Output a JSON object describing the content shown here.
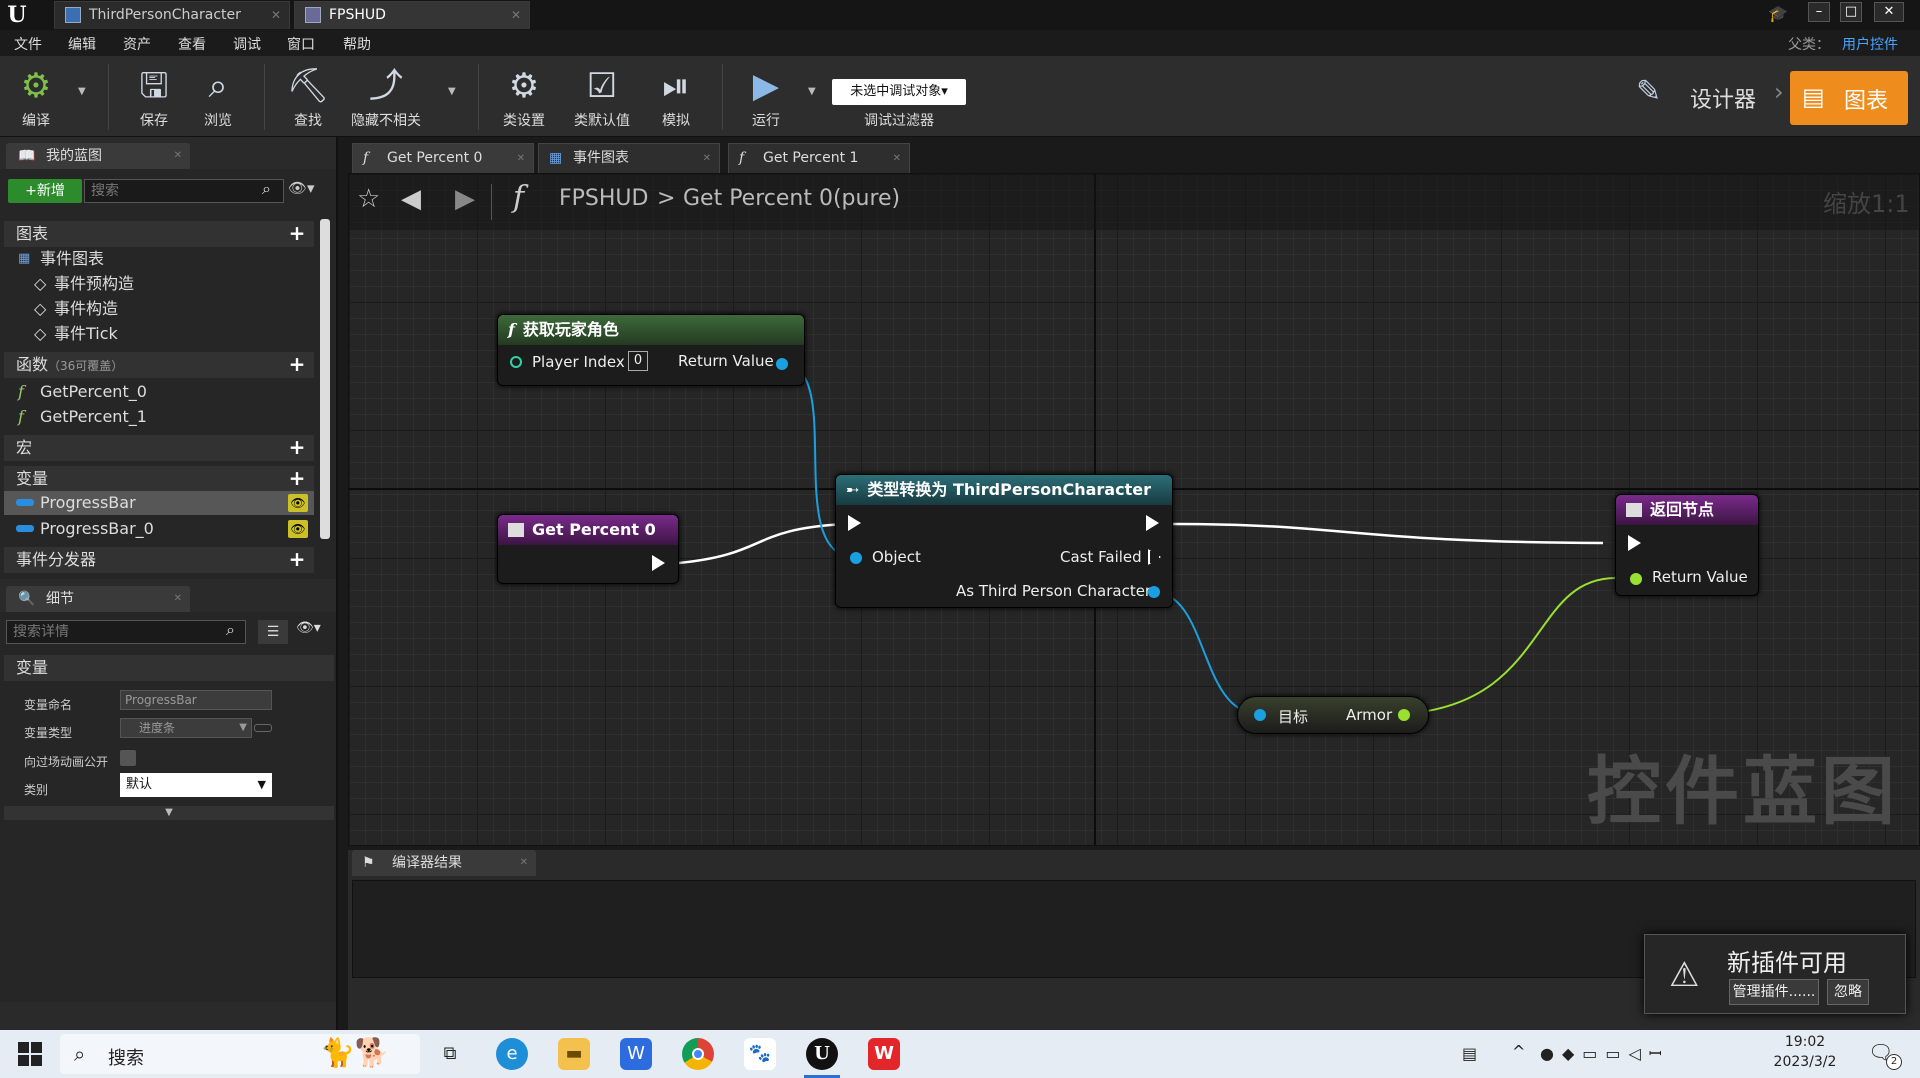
{
  "tabs": {
    "tab1": "ThirdPersonCharacter",
    "tab2": "FPSHUD"
  },
  "menu": [
    "文件",
    "编辑",
    "资产",
    "查看",
    "调试",
    "窗口",
    "帮助"
  ],
  "parent": {
    "label": "父类：",
    "value": "用户控件"
  },
  "toolbar": {
    "compile": "编译",
    "save": "保存",
    "browse": "浏览",
    "find": "查找",
    "hide": "隐藏不相关",
    "classSettings": "类设置",
    "classDefaults": "类默认值",
    "simulate": "模拟",
    "run": "运行",
    "debugDropdown": "未选中调试对象▾",
    "debugFilter": "调试过滤器",
    "designer": "设计器",
    "graph": "图表"
  },
  "myblueprint": {
    "title": "我的蓝图",
    "addNew": "+新增",
    "searchPlaceholder": "搜索",
    "sectionGraphs": "图表",
    "eventGraph": "事件图表",
    "events": [
      "事件预构造",
      "事件构造",
      "事件Tick"
    ],
    "sectionFunctions": "函数",
    "functionsNote": "（36可覆盖）",
    "functions": [
      "GetPercent_0",
      "GetPercent_1"
    ],
    "sectionMacros": "宏",
    "sectionVariables": "变量",
    "variables": [
      "ProgressBar",
      "ProgressBar_0"
    ],
    "sectionDispatchers": "事件分发器"
  },
  "details": {
    "title": "细节",
    "searchPlaceholder": "搜索详情",
    "section": "变量",
    "rows": [
      {
        "label": "变量命名",
        "value": "ProgressBar"
      },
      {
        "label": "变量类型",
        "value": "进度条"
      },
      {
        "label": "向过场动画公开",
        "value": ""
      },
      {
        "label": "类别",
        "value": "默认"
      }
    ]
  },
  "graphTabs": [
    "Get Percent 0",
    "事件图表",
    "Get Percent 1"
  ],
  "breadcrumb": {
    "root": "FPSHUD",
    "sep": ">",
    "current": "Get Percent 0(pure)",
    "zoom": "缩放1:1"
  },
  "nodes": {
    "getPlayer": {
      "title": "获取玩家角色",
      "pinIn": "Player Index",
      "pinInValue": "0",
      "pinOut": "Return Value"
    },
    "entry": {
      "title": "Get Percent 0"
    },
    "cast": {
      "title": "类型转换为 ThirdPersonCharacter",
      "object": "Object",
      "failed": "Cast Failed",
      "asChar": "As Third Person Character"
    },
    "ret": {
      "title": "返回节点",
      "pinIn": "Return Value"
    },
    "armor": {
      "target": "目标",
      "armor": "Armor"
    }
  },
  "watermark": "控件蓝图",
  "compiler": {
    "title": "编译器结果"
  },
  "notification": {
    "title": "新插件可用",
    "manage": "管理插件......",
    "ignore": "忽略"
  },
  "taskbar": {
    "search": "搜索",
    "time": "19:02",
    "date": "2023/3/2",
    "notifCount": "2"
  }
}
